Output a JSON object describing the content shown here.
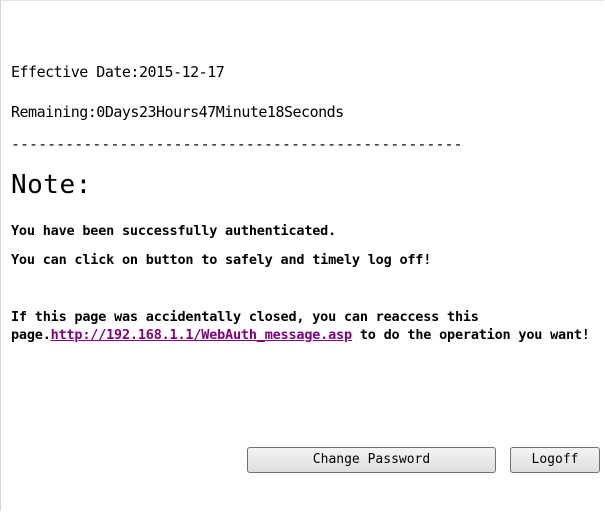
{
  "info": {
    "effective_date": "Effective Date:2015-12-17",
    "remaining": "Remaining:0Days23Hours47Minute18Seconds",
    "separator": "--------------------------------------------------"
  },
  "note": {
    "title": "Note:",
    "line1": "You have been successfully authenticated.",
    "line2": "You can click on button to safely and timely log off!",
    "line3_before": "If this page was accidentally closed, you can reaccess this page.",
    "link": "http://192.168.1.1/WebAuth_message.asp",
    "line3_after": " to do the operation you want!"
  },
  "buttons": {
    "change_password": "Change Password",
    "logoff": "Logoff"
  },
  "colors": {
    "link": "#800080",
    "text": "#000000",
    "background": "#ffffff"
  }
}
